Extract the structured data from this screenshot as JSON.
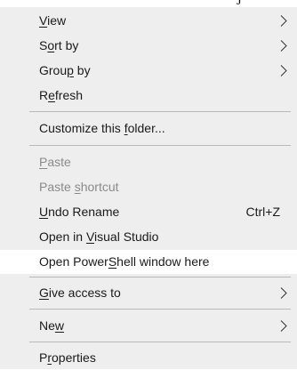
{
  "context_menu": {
    "view": {
      "pre": "",
      "acc": "V",
      "post": "iew"
    },
    "sort_by": {
      "pre": "S",
      "acc": "o",
      "post": "rt by"
    },
    "group_by": {
      "pre": "Grou",
      "acc": "p",
      "post": " by"
    },
    "refresh": {
      "pre": "R",
      "acc": "e",
      "post": "fresh"
    },
    "customize": {
      "pre": "Customize this ",
      "acc": "f",
      "post": "older..."
    },
    "paste": {
      "pre": "",
      "acc": "P",
      "post": "aste"
    },
    "paste_shortcut": {
      "pre": "Paste ",
      "acc": "s",
      "post": "hortcut"
    },
    "undo_rename": {
      "pre": "",
      "acc": "U",
      "post": "ndo Rename",
      "shortcut": "Ctrl+Z"
    },
    "open_vs": {
      "pre": "Open in ",
      "acc": "V",
      "post": "isual Studio"
    },
    "open_powershell": {
      "pre": "Open Power",
      "acc": "S",
      "post": "hell window here"
    },
    "give_access": {
      "pre": "",
      "acc": "G",
      "post": "ive access to"
    },
    "new": {
      "pre": "Ne",
      "acc": "w",
      "post": ""
    },
    "properties": {
      "pre": "P",
      "acc": "r",
      "post": "operties"
    }
  },
  "icons": {
    "submenu_arrow": "chevron-right-icon"
  },
  "colors": {
    "menu_background": "#eeeeee",
    "highlight_background": "#ffffff",
    "disabled_text": "#8a8a8a",
    "separator": "#b8b8b8"
  }
}
